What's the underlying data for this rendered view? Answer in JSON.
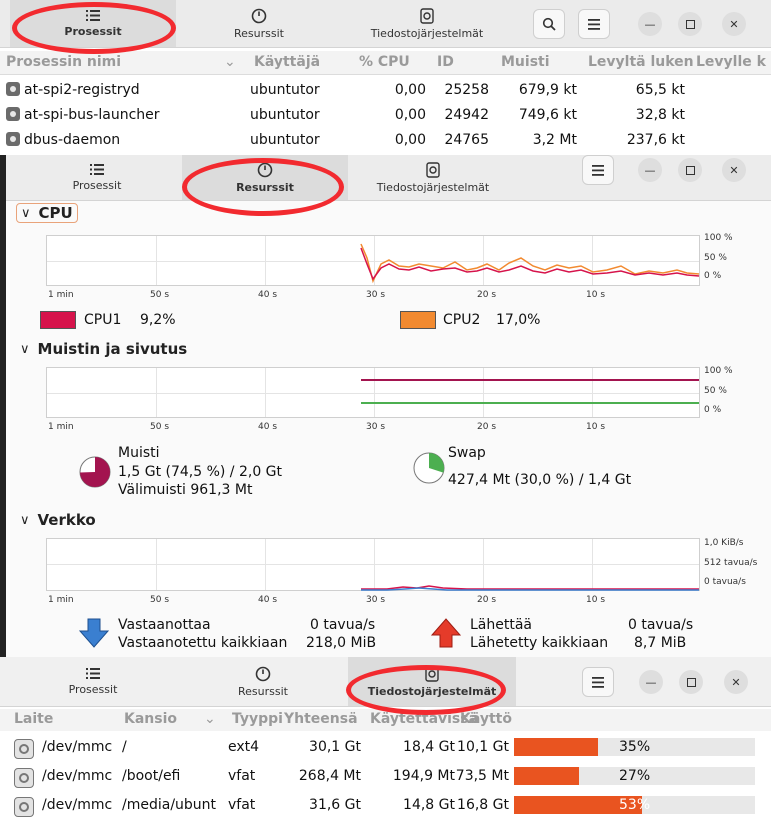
{
  "tabs": {
    "processes": "Prosessit",
    "resources": "Resurssit",
    "filesystems": "Tiedostojärjestelmät"
  },
  "process_table": {
    "headers": [
      "Prosessin nimi",
      "Käyttäjä",
      "% CPU",
      "ID",
      "Muisti",
      "Levyltä luken",
      "Levylle k"
    ],
    "rows": [
      {
        "name": "at-spi2-registryd",
        "user": "ubuntutor",
        "cpu": "0,00",
        "id": "25258",
        "memory": "679,9 kt",
        "disk_read": "65,5 kt"
      },
      {
        "name": "at-spi-bus-launcher",
        "user": "ubuntutor",
        "cpu": "0,00",
        "id": "24942",
        "memory": "749,6 kt",
        "disk_read": "32,8 kt"
      },
      {
        "name": "dbus-daemon",
        "user": "ubuntutor",
        "cpu": "0,00",
        "id": "24765",
        "memory": "3,2 Mt",
        "disk_read": "237,6 kt"
      }
    ]
  },
  "resources": {
    "time_ticks": [
      "1 min",
      "50 s",
      "40 s",
      "30 s",
      "20 s",
      "10 s"
    ],
    "cpu": {
      "title": "CPU",
      "y_ticks": [
        "100 %",
        "50 %",
        "0 %"
      ],
      "cpu1_label": "CPU1",
      "cpu1_value": "9,2%",
      "cpu1_color": "#d6134b",
      "cpu2_label": "CPU2",
      "cpu2_value": "17,0%",
      "cpu2_color": "#f28a30"
    },
    "memory": {
      "title": "Muistin ja sivutus",
      "y_ticks": [
        "100 %",
        "50 %",
        "0 %"
      ],
      "mem_label": "Muisti",
      "mem_line1": "1,5 Gt (74,5 %) / 2,0 Gt",
      "mem_line2": "Välimuisti 961,3 Mt",
      "mem_fraction": 0.745,
      "mem_color": "#a3144f",
      "swap_label": "Swap",
      "swap_line1": "427,4 Mt (30,0 %) / 1,4 Gt",
      "swap_fraction": 0.3,
      "swap_color": "#4caf50"
    },
    "network": {
      "title": "Verkko",
      "y_ticks": [
        "1,0 KiB/s",
        "512 tavua/s",
        "0 tavua/s"
      ],
      "recv_label": "Vastaanottaa",
      "recv_rate": "0 tavua/s",
      "recv_total_label": "Vastaanotettu kaikkiaan",
      "recv_total": "218,0 MiB",
      "send_label": "Lähettää",
      "send_rate": "0 tavua/s",
      "send_total_label": "Lähetetty kaikkiaan",
      "send_total": "8,7 MiB"
    }
  },
  "fs_table": {
    "headers": [
      "Laite",
      "Kansio",
      "Tyyppi",
      "Yhteensä",
      "Käytettävissä",
      "Käyttö"
    ],
    "rows": [
      {
        "device": "/dev/mmc",
        "folder": "/",
        "type": "ext4",
        "total": "30,1 Gt",
        "free": "18,4 Gt",
        "used": "10,1 Gt",
        "percent": "35%",
        "fraction": 0.35
      },
      {
        "device": "/dev/mmc",
        "folder": "/boot/efi",
        "type": "vfat",
        "total": "268,4 Mt",
        "free": "194,9 Mt",
        "used": "73,5 Mt",
        "percent": "27%",
        "fraction": 0.27
      },
      {
        "device": "/dev/mmc",
        "folder": "/media/ubunt",
        "type": "vfat",
        "total": "31,6 Gt",
        "free": "14,8 Gt",
        "used": "16,8 Gt",
        "percent": "53%",
        "fraction": 0.53
      }
    ]
  },
  "icons": {
    "search": "search-icon",
    "menu": "hamburger-menu-icon",
    "minimize": "minimize-icon",
    "maximize": "maximize-icon",
    "close": "close-icon"
  },
  "colors": {
    "accent": "#e95420",
    "highlight_ring": "#f22a2f"
  }
}
